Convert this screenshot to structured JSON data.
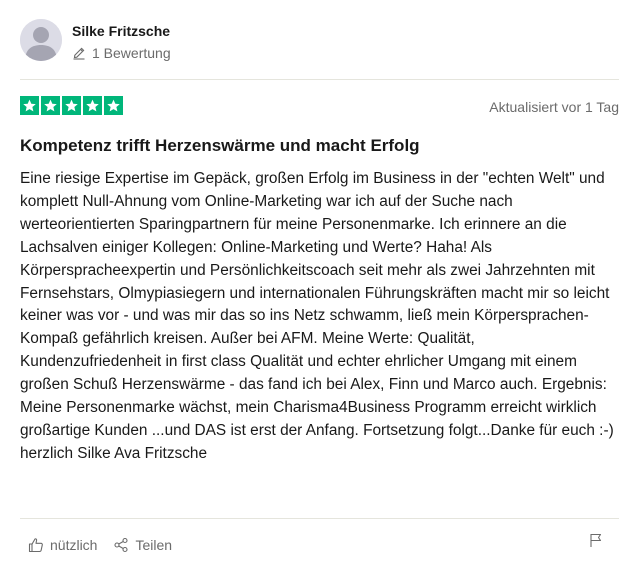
{
  "reviewer": {
    "name": "Silke Fritzsche",
    "review_count": "1 Bewertung",
    "avatar_icon": "person-silhouette-icon"
  },
  "rating": {
    "stars": 5,
    "max_stars": 5,
    "star_color": "#00b67a",
    "updated": "Aktualisiert vor 1 Tag"
  },
  "review": {
    "title": "Kompetenz trifft Herzenswärme und macht Erfolg",
    "body": "Eine riesige Expertise im Gepäck, großen Erfolg im Business in der \"echten Welt\" und komplett Null-Ahnung vom Online-Marketing war ich auf der Suche nach werteorientierten Sparingpartnern für meine Personenmarke. Ich erinnere an die Lachsalven einiger Kollegen: Online-Marketing und Werte? Haha! Als Körperspracheexpertin und Persönlichkeitscoach seit mehr als zwei Jahrzehnten mit Fernsehstars, Olmypiasiegern und internationalen Führungskräften macht mir so leicht keiner was vor - und was mir das so ins Netz schwamm, ließ mein Körpersprachen-Kompaß gefährlich kreisen. Außer bei AFM. Meine Werte: Qualität, Kundenzufriedenheit in first class Qualität und echter ehrlicher Umgang mit einem großen Schuß Herzenswärme - das fand ich bei Alex, Finn und Marco auch. Ergebnis: Meine Personenmarke wächst, mein Charisma4Business Programm erreicht wirklich großartige Kunden ...und DAS ist erst der Anfang. Fortsetzung folgt...Danke für euch :-) herzlich Silke Ava Fritzsche"
  },
  "actions": {
    "helpful_label": "nützlich",
    "share_label": "Teilen",
    "helpful_icon": "thumbs-up-icon",
    "share_icon": "share-icon",
    "flag_icon": "flag-icon"
  }
}
